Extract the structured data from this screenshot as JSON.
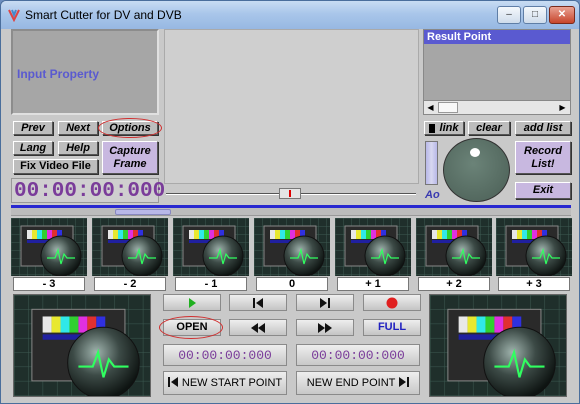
{
  "window": {
    "title": "Smart Cutter for DV and DVB",
    "min": "–",
    "max": "□",
    "close": "✕"
  },
  "left": {
    "input_property": "Input Property",
    "prev": "Prev",
    "next": "Next",
    "options": "Options",
    "lang": "Lang",
    "help": "Help",
    "capture_frame_1": "Capture",
    "capture_frame_2": "Frame",
    "fix_video_file": "Fix Video File",
    "timecode": "00:00:00:000"
  },
  "right": {
    "result_point": "Result Point",
    "link": "link",
    "clear": "clear",
    "add_list": "add list",
    "record_1": "Record",
    "record_2": "List!",
    "exit": "Exit",
    "ao": "Ao"
  },
  "thumbs": [
    "- 3",
    "- 2",
    "- 1",
    "0",
    "+ 1",
    "+ 2",
    "+ 3"
  ],
  "controls": {
    "open": "OPEN",
    "full": "FULL",
    "start_time": "00:00:00:000",
    "end_time": "00:00:00:000",
    "new_start_point": "NEW START POINT",
    "new_end_point": "NEW END POINT"
  },
  "colors": {
    "accent": "#5a5ad0",
    "timecode": "#7a3c9a",
    "record": "#e02020",
    "play": "#20b020"
  }
}
